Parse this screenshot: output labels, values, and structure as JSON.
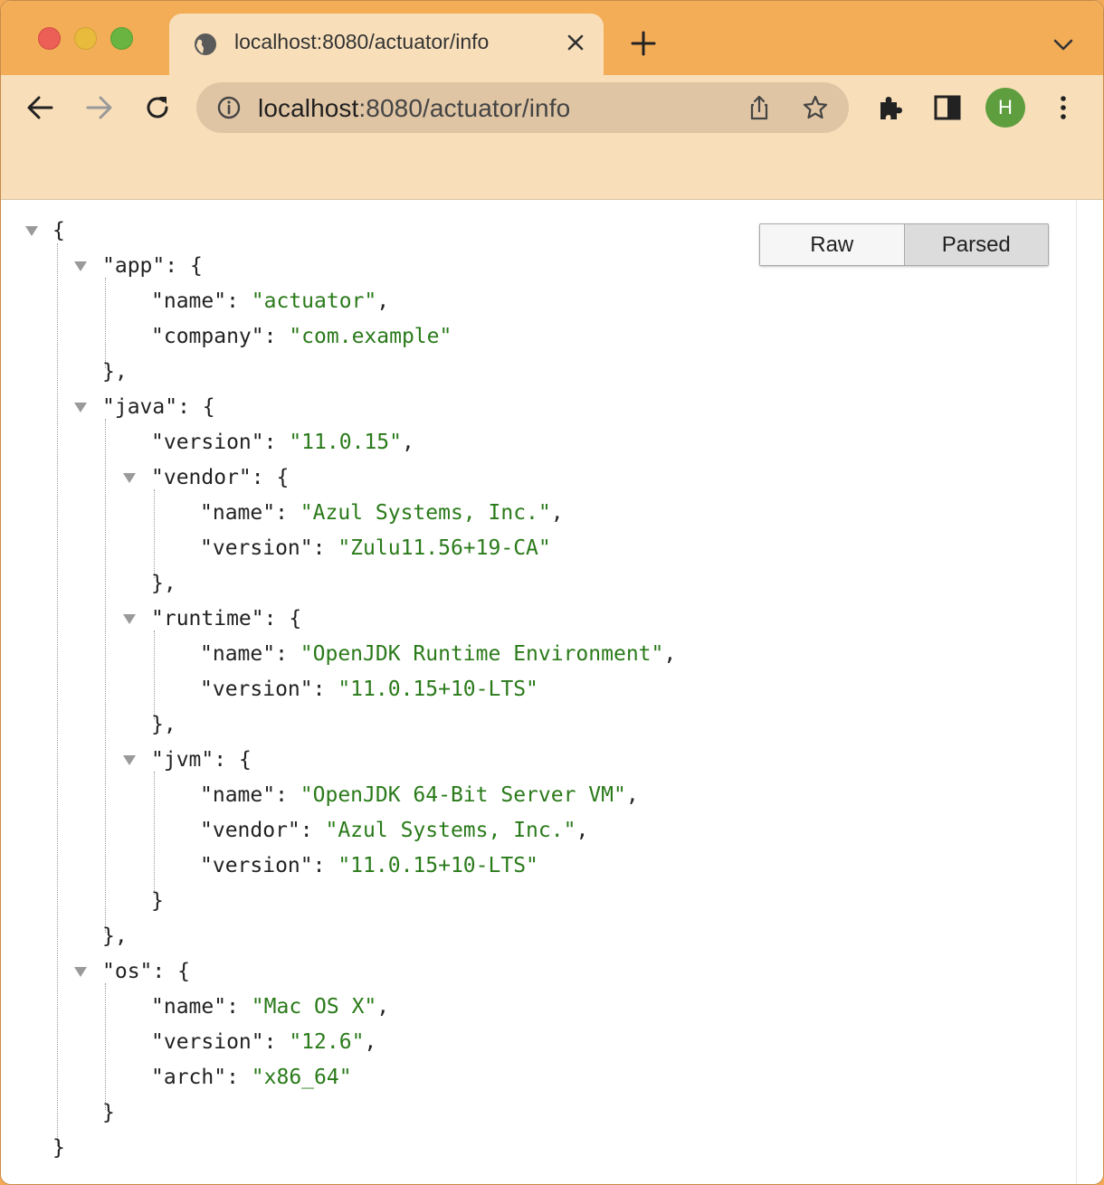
{
  "tab": {
    "title": "localhost:8080/actuator/info"
  },
  "omnibox": {
    "host": "localhost",
    "rest": ":8080/actuator/info"
  },
  "profile": {
    "initial": "H",
    "color": "#5f9e3f"
  },
  "view_toggle": {
    "raw_label": "Raw",
    "parsed_label": "Parsed",
    "selected": "Parsed"
  },
  "json": {
    "open": "{",
    "app": {
      "key": "\"app\"",
      "name_key": "\"name\"",
      "name_val": "\"actuator\"",
      "company_key": "\"company\"",
      "company_val": "\"com.example\""
    },
    "java": {
      "key": "\"java\"",
      "version_key": "\"version\"",
      "version_val": "\"11.0.15\"",
      "vendor": {
        "key": "\"vendor\"",
        "name_key": "\"name\"",
        "name_val": "\"Azul Systems, Inc.\"",
        "version_key": "\"version\"",
        "version_val": "\"Zulu11.56+19-CA\""
      },
      "runtime": {
        "key": "\"runtime\"",
        "name_key": "\"name\"",
        "name_val": "\"OpenJDK Runtime Environment\"",
        "version_key": "\"version\"",
        "version_val": "\"11.0.15+10-LTS\""
      },
      "jvm": {
        "key": "\"jvm\"",
        "name_key": "\"name\"",
        "name_val": "\"OpenJDK 64-Bit Server VM\"",
        "vendor_key": "\"vendor\"",
        "vendor_val": "\"Azul Systems, Inc.\"",
        "version_key": "\"version\"",
        "version_val": "\"11.0.15+10-LTS\""
      }
    },
    "os": {
      "key": "\"os\"",
      "name_key": "\"name\"",
      "name_val": "\"Mac OS X\"",
      "version_key": "\"version\"",
      "version_val": "\"12.6\"",
      "arch_key": "\"arch\"",
      "arch_val": "\"x86_64\""
    },
    "close": "}"
  },
  "colors": {
    "tab_bar": "#f3ad57",
    "toolbar": "#f8dfba",
    "json_string": "#2a7a1a"
  }
}
